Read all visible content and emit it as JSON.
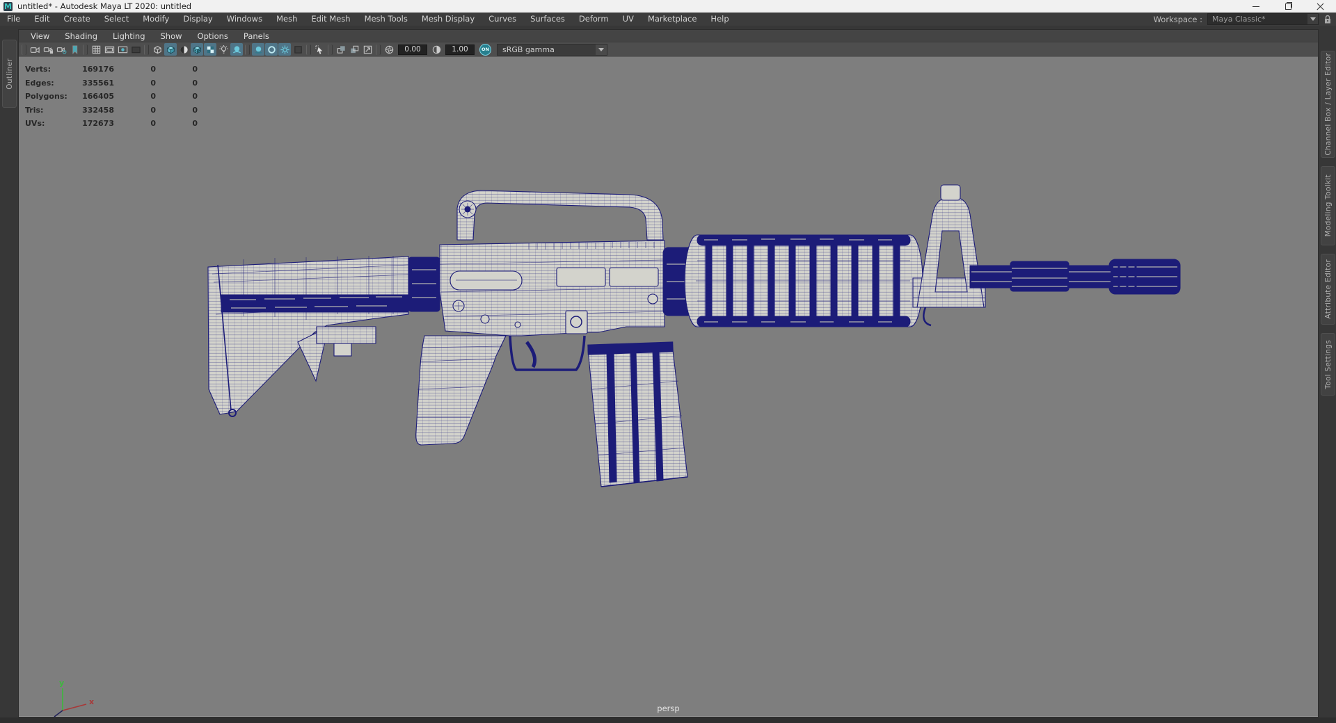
{
  "window": {
    "app_icon_letter": "M",
    "title": "untitled* - Autodesk Maya LT 2020: untitled"
  },
  "menu_bar": {
    "items": [
      "File",
      "Edit",
      "Create",
      "Select",
      "Modify",
      "Display",
      "Windows",
      "Mesh",
      "Edit Mesh",
      "Mesh Tools",
      "Mesh Display",
      "Curves",
      "Surfaces",
      "Deform",
      "UV",
      "Marketplace",
      "Help"
    ],
    "workspace_label": "Workspace :",
    "workspace_value": "Maya Classic*"
  },
  "panel_menu": {
    "items": [
      "View",
      "Shading",
      "Lighting",
      "Show",
      "Options",
      "Panels"
    ]
  },
  "toolbar": {
    "exposure_value": "0.00",
    "contrast_value": "1.00",
    "on_label": "ON",
    "gamma_value": "sRGB gamma",
    "icons": [
      "select-camera",
      "lock-camera",
      "camera-attributes",
      "bookmark",
      "grid",
      "film-gate",
      "resolution-gate",
      "gate-mask",
      "wireframe-mode",
      "smooth-shade",
      "wireframe-on-shaded",
      "textured-mode",
      "use-all-lights",
      "default-lighting",
      "shadows",
      "ssao",
      "motion-blur",
      "anti-aliasing",
      "depth-of-field",
      "select-tool",
      "isolate-select",
      "isolate-selected-view",
      "zoom-region",
      "exposure",
      "contrast",
      "color-management-toggle",
      "view-transform-select"
    ]
  },
  "hud": {
    "rows": [
      {
        "label": "Verts:",
        "value": "169176",
        "c2": "0",
        "c3": "0"
      },
      {
        "label": "Edges:",
        "value": "335561",
        "c2": "0",
        "c3": "0"
      },
      {
        "label": "Polygons:",
        "value": "166405",
        "c2": "0",
        "c3": "0"
      },
      {
        "label": "Tris:",
        "value": "332458",
        "c2": "0",
        "c3": "0"
      },
      {
        "label": "UVs:",
        "value": "172673",
        "c2": "0",
        "c3": "0"
      }
    ]
  },
  "sidebars": {
    "left_tabs": [
      "Outliner"
    ],
    "right_tabs": [
      "Channel Box / Layer Editor",
      "Modeling Toolkit",
      "Attribute Editor",
      "Tool Settings"
    ]
  },
  "viewport": {
    "camera_label": "persp",
    "axis_x": "x",
    "axis_y": "y",
    "model": "M4 carbine polygon mesh (wireframe on shaded)"
  },
  "colors": {
    "titlebar-bg": "#f1f1f1",
    "menubar-bg": "#3c3c3c",
    "frame-bg": "#373737",
    "pmenu-bg": "#444444",
    "toolbar-bg": "#4e4e4e",
    "viewport-bg": "#7e7e7e",
    "navy": "#1c1c78",
    "body": "#d3d3cc",
    "teal": "#6cc9dc",
    "active-tile": "#4f7588",
    "hud-text": "#272727",
    "axis-y": "#3cb83c",
    "axis-x": "#a83838"
  }
}
